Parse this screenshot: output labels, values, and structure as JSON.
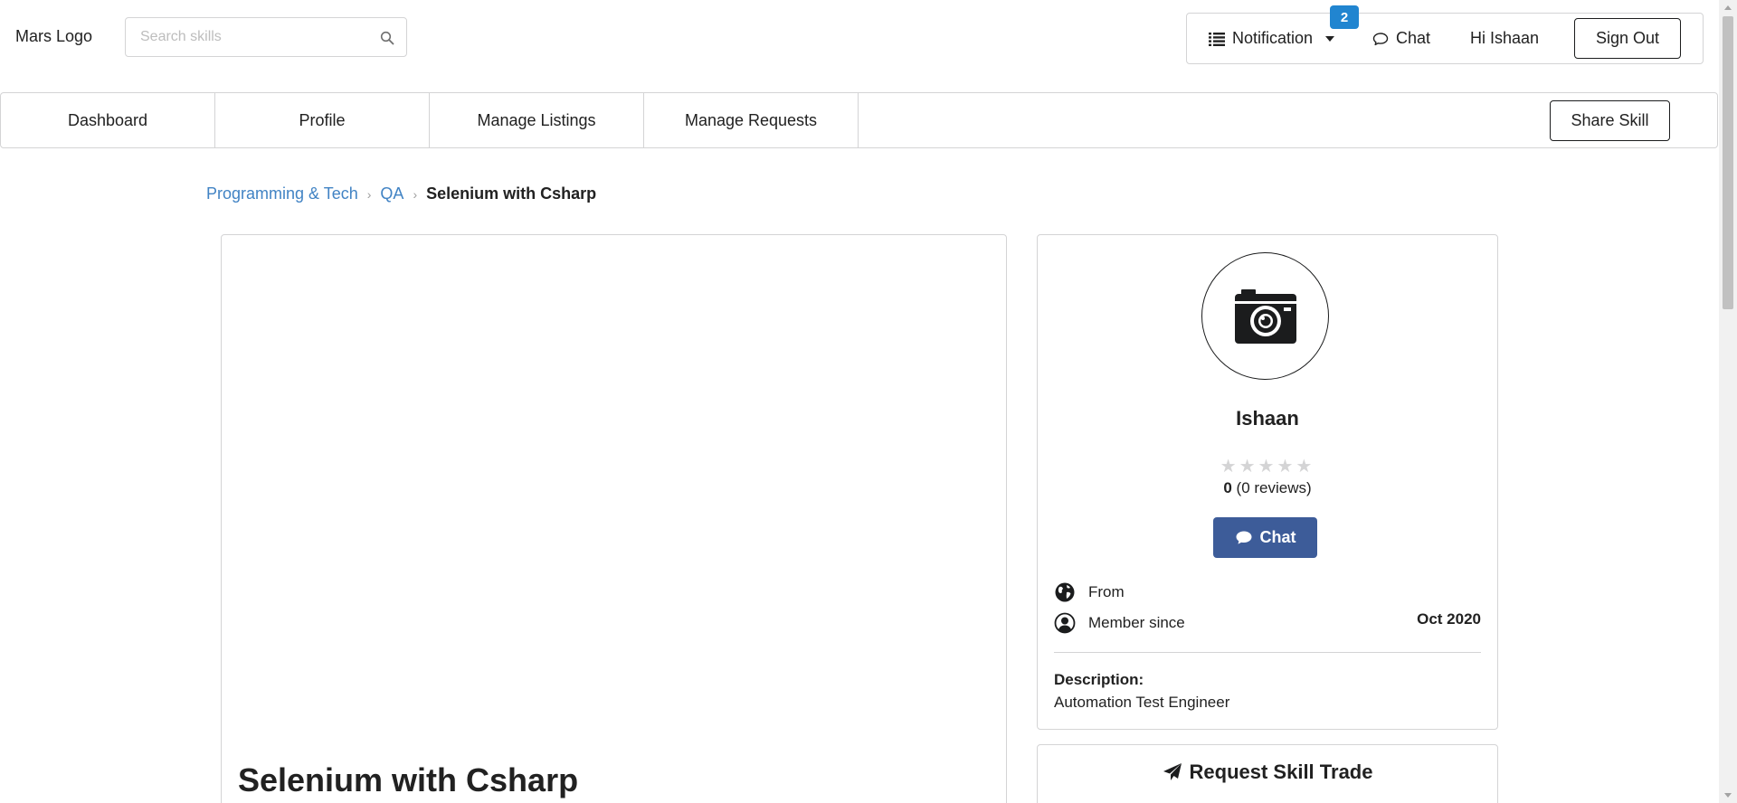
{
  "header": {
    "logo_text": "Mars Logo",
    "search_placeholder": "Search skills",
    "notification_label": "Notification",
    "notification_count": "2",
    "chat_label": "Chat",
    "greeting": "Hi Ishaan",
    "signout_label": "Sign Out"
  },
  "nav": {
    "items": [
      {
        "label": "Dashboard"
      },
      {
        "label": "Profile"
      },
      {
        "label": "Manage Listings"
      },
      {
        "label": "Manage Requests"
      }
    ],
    "share_label": "Share Skill"
  },
  "breadcrumb": {
    "items": [
      "Programming & Tech",
      "QA"
    ],
    "active": "Selenium with Csharp",
    "divider": "›"
  },
  "skill": {
    "title": "Selenium with Csharp"
  },
  "profile": {
    "name": "Ishaan",
    "stars": "★★★★★",
    "star_rating": 0,
    "rating_value": "0",
    "reviews_text": "(0 reviews)",
    "chat_button": "Chat",
    "from_label": "From",
    "from_value": "",
    "member_since_label": "Member since",
    "member_since_value": "Oct 2020",
    "description_label": "Description:",
    "description_value": "Automation Test Engineer"
  },
  "request": {
    "label": "Request Skill Trade"
  },
  "colors": {
    "link": "#4183c4",
    "badge": "#2185d0",
    "chat_button": "#3d5c99",
    "border": "#d4d4d5",
    "text": "#212121"
  }
}
